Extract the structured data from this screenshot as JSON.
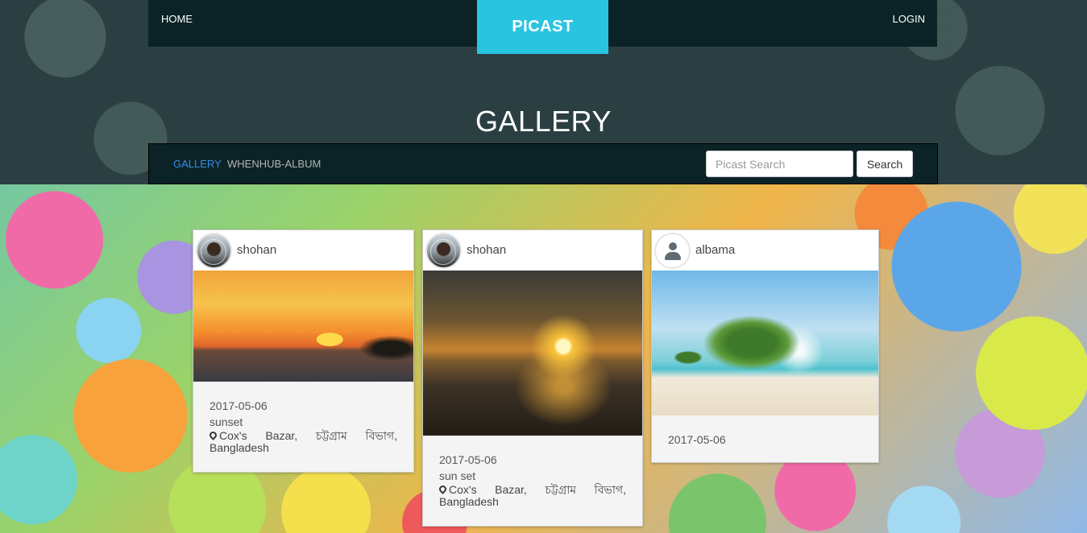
{
  "header": {
    "home_label": "HOME",
    "brand": "PICAST",
    "login_label": "LOGIN",
    "page_title": "GALLERY"
  },
  "subnav": {
    "tabs": [
      {
        "label": "GALLERY",
        "active": true
      },
      {
        "label": "WHENHUB-ALBUM",
        "active": false
      }
    ],
    "search_placeholder": "Picast Search",
    "search_button": "Search"
  },
  "colors": {
    "brand": "#29c4e0",
    "header_dark": "#0b2327",
    "active_tab": "#3a8be8"
  },
  "cards": [
    {
      "username": "shohan",
      "avatar": "user-photo",
      "image": "sunset-over-sea",
      "date": "2017-05-06",
      "caption": "sunset",
      "location": "Cox's Bazar, চট্টগ্রাম বিভাগ, Bangladesh"
    },
    {
      "username": "shohan",
      "avatar": "user-photo",
      "image": "sunset-over-beach",
      "date": "2017-05-06",
      "caption": "sun set",
      "location": "Cox's Bazar, চট্টগ্রাম বিভাগ, Bangladesh"
    },
    {
      "username": "albama",
      "avatar": "default-user-icon",
      "image": "tree-on-beach",
      "date": "2017-05-06"
    }
  ]
}
